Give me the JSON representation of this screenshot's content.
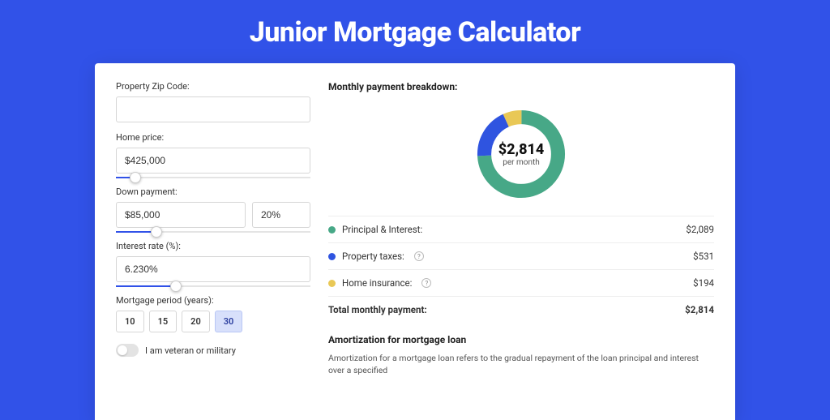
{
  "page": {
    "title": "Junior Mortgage Calculator"
  },
  "form": {
    "zip_label": "Property Zip Code:",
    "zip_value": "",
    "home_price_label": "Home price:",
    "home_price_value": "$425,000",
    "down_payment_label": "Down payment:",
    "down_payment_value": "$85,000",
    "down_payment_pct": "20%",
    "interest_label": "Interest rate (%):",
    "interest_value": "6.230%",
    "period_label": "Mortgage period (years):",
    "periods": [
      "10",
      "15",
      "20",
      "30"
    ],
    "period_selected": "30",
    "military_label": "I am veteran or military",
    "military_on": false
  },
  "breakdown": {
    "title": "Monthly payment breakdown:",
    "center_value": "$2,814",
    "center_sub": "per month",
    "rows": [
      {
        "label": "Principal & Interest:",
        "value": "$2,089",
        "color": "green",
        "info": false
      },
      {
        "label": "Property taxes:",
        "value": "$531",
        "color": "blue",
        "info": true
      },
      {
        "label": "Home insurance:",
        "value": "$194",
        "color": "yellow",
        "info": true
      }
    ],
    "total_label": "Total monthly payment:",
    "total_value": "$2,814"
  },
  "amort": {
    "title": "Amortization for mortgage loan",
    "body": "Amortization for a mortgage loan refers to the gradual repayment of the loan principal and interest over a specified"
  },
  "chart_data": {
    "type": "pie",
    "title": "Monthly payment breakdown",
    "categories": [
      "Principal & Interest",
      "Property taxes",
      "Home insurance"
    ],
    "values": [
      2089,
      531,
      194
    ],
    "colors": [
      "#47a887",
      "#2f54e0",
      "#e9c856"
    ],
    "total": 2814
  }
}
